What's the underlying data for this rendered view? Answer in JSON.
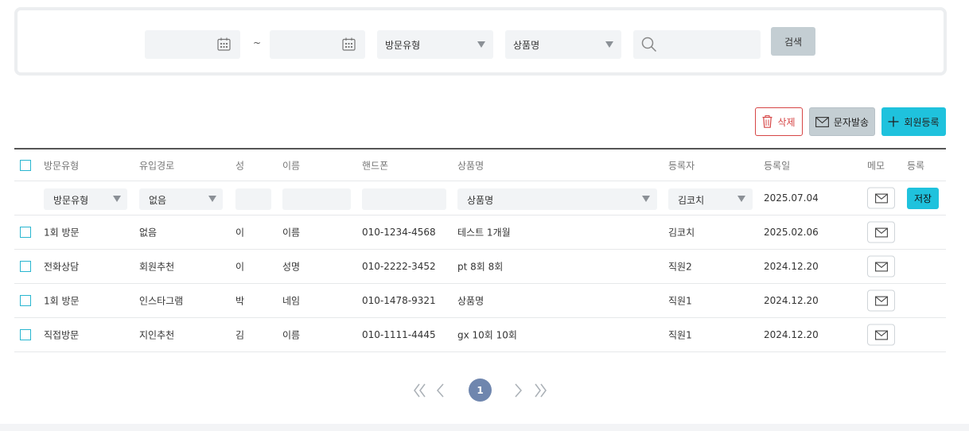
{
  "filter": {
    "tilde": "~",
    "visit_type_label": "방문유형",
    "product_label": "상품명",
    "search_placeholder": "",
    "search_button": "검색"
  },
  "actions": {
    "delete_label": "삭제",
    "sms_label": "문자발송",
    "register_label": "회원등록"
  },
  "colors": {
    "accent": "#1fc2dd",
    "delete": "#d64545",
    "pager_current": "#6f86ae"
  },
  "table": {
    "columns": [
      "방문유형",
      "유입경로",
      "성",
      "이름",
      "핸드폰",
      "상품명",
      "등록자",
      "등록일",
      "메모",
      "등록"
    ],
    "input_row": {
      "visit_type": "방문유형",
      "source": "없음",
      "last_name": "",
      "first_name": "",
      "phone": "",
      "product": "상품명",
      "registrar": "김코치",
      "date": "2025.07.04",
      "save_label": "저장"
    },
    "rows": [
      {
        "visit_type": "1회 방문",
        "source": "없음",
        "last_name": "이",
        "first_name": "이름",
        "phone": "010-1234-4568",
        "product": "테스트 1개월",
        "registrar": "김코치",
        "date": "2025.02.06"
      },
      {
        "visit_type": "전화상담",
        "source": "회원추천",
        "last_name": "이",
        "first_name": "성명",
        "phone": "010-2222-3452",
        "product": "pt 8회 8회",
        "registrar": "직원2",
        "date": "2024.12.20"
      },
      {
        "visit_type": "1회 방문",
        "source": "인스타그램",
        "last_name": "박",
        "first_name": "네임",
        "phone": "010-1478-9321",
        "product": "상품명",
        "registrar": "직원1",
        "date": "2024.12.20"
      },
      {
        "visit_type": "직접방문",
        "source": "지인추천",
        "last_name": "김",
        "first_name": "이름",
        "phone": "010-1111-4445",
        "product": "gx 10회 10회",
        "registrar": "직원1",
        "date": "2024.12.20"
      }
    ]
  },
  "pagination": {
    "current": "1",
    "icons": [
      "double-chevron-left-icon",
      "chevron-left-icon",
      "chevron-right-icon",
      "double-chevron-right-icon"
    ]
  }
}
